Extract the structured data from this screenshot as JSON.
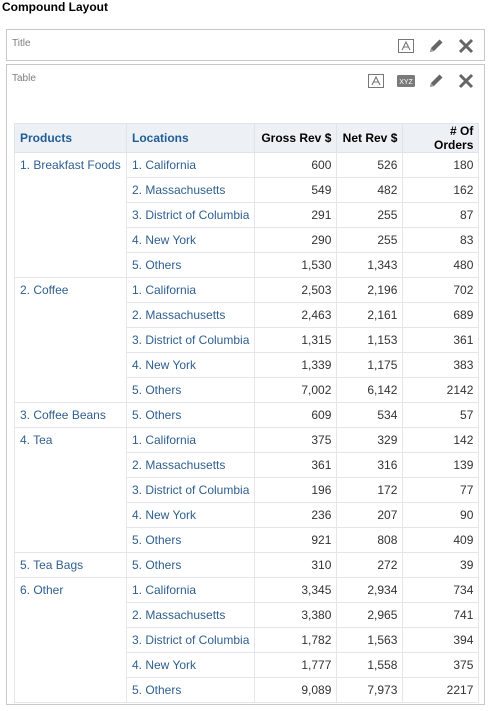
{
  "page": {
    "title": "Compound Layout"
  },
  "title_view": {
    "label": "Title"
  },
  "table_view": {
    "label": "Table"
  },
  "icons": {
    "format": "format-text-icon",
    "xyz": "xyz-icon",
    "edit": "pencil-icon",
    "close": "close-icon"
  },
  "icon_text": {
    "xyz": "XYZ"
  },
  "table": {
    "headers": [
      "Products",
      "Locations",
      "Gross Rev $",
      "Net Rev $",
      "# Of Orders"
    ],
    "groups": [
      {
        "product": "1. Breakfast Foods",
        "rows": [
          [
            "1. California",
            "600",
            "526",
            "180"
          ],
          [
            "2. Massachusetts",
            "549",
            "482",
            "162"
          ],
          [
            "3. District of Columbia",
            "291",
            "255",
            "87"
          ],
          [
            "4. New York",
            "290",
            "255",
            "83"
          ],
          [
            "5. Others",
            "1,530",
            "1,343",
            "480"
          ]
        ]
      },
      {
        "product": "2. Coffee",
        "rows": [
          [
            "1. California",
            "2,503",
            "2,196",
            "702"
          ],
          [
            "2. Massachusetts",
            "2,463",
            "2,161",
            "689"
          ],
          [
            "3. District of Columbia",
            "1,315",
            "1,153",
            "361"
          ],
          [
            "4. New York",
            "1,339",
            "1,175",
            "383"
          ],
          [
            "5. Others",
            "7,002",
            "6,142",
            "2142"
          ]
        ]
      },
      {
        "product": "3. Coffee Beans",
        "rows": [
          [
            "5. Others",
            "609",
            "534",
            "57"
          ]
        ]
      },
      {
        "product": "4. Tea",
        "rows": [
          [
            "1. California",
            "375",
            "329",
            "142"
          ],
          [
            "2. Massachusetts",
            "361",
            "316",
            "139"
          ],
          [
            "3. District of Columbia",
            "196",
            "172",
            "77"
          ],
          [
            "4. New York",
            "236",
            "207",
            "90"
          ],
          [
            "5. Others",
            "921",
            "808",
            "409"
          ]
        ]
      },
      {
        "product": "5. Tea Bags",
        "rows": [
          [
            "5. Others",
            "310",
            "272",
            "39"
          ]
        ]
      },
      {
        "product": "6. Other",
        "rows": [
          [
            "1. California",
            "3,345",
            "2,934",
            "734"
          ],
          [
            "2. Massachusetts",
            "3,380",
            "2,965",
            "741"
          ],
          [
            "3. District of Columbia",
            "1,782",
            "1,563",
            "394"
          ],
          [
            "4. New York",
            "1,777",
            "1,558",
            "375"
          ],
          [
            "5. Others",
            "9,089",
            "7,973",
            "2217"
          ]
        ]
      }
    ]
  },
  "colors": {
    "link": "#2f5f8f",
    "header_bg": "#edf1f6",
    "icon_gray": "#666666"
  }
}
